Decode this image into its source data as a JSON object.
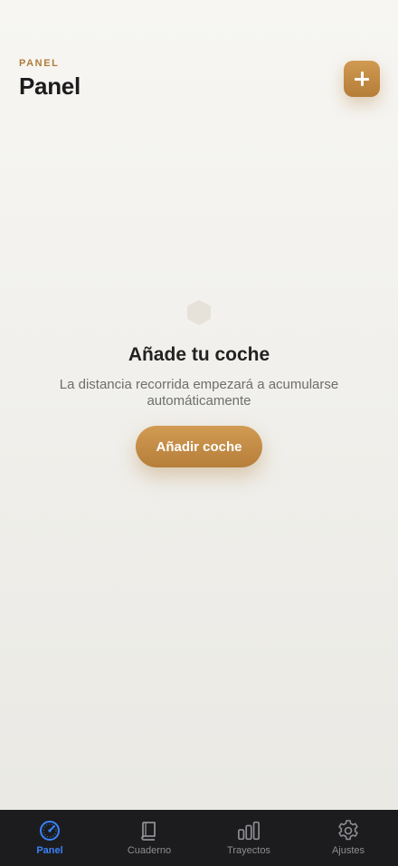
{
  "header": {
    "eyebrow": "PANEL",
    "title": "Panel",
    "add_button_icon": "plus-icon"
  },
  "empty_state": {
    "icon": "hexagon-icon",
    "title": "Añade tu coche",
    "description": "La distancia recorrida empezará a acumularse automáticamente",
    "button_label": "Añadir coche"
  },
  "tabbar": {
    "items": [
      {
        "label": "Panel",
        "icon": "gauge-icon",
        "active": true
      },
      {
        "label": "Cuaderno",
        "icon": "book-icon",
        "active": false
      },
      {
        "label": "Trayectos",
        "icon": "bars-icon",
        "active": false
      },
      {
        "label": "Ajustes",
        "icon": "gear-icon",
        "active": false
      }
    ]
  },
  "colors": {
    "accent": "#c08a45",
    "active_tab": "#3a82f7",
    "tabbar_bg": "#1c1c1e",
    "inactive_tab": "#8e8e93"
  }
}
